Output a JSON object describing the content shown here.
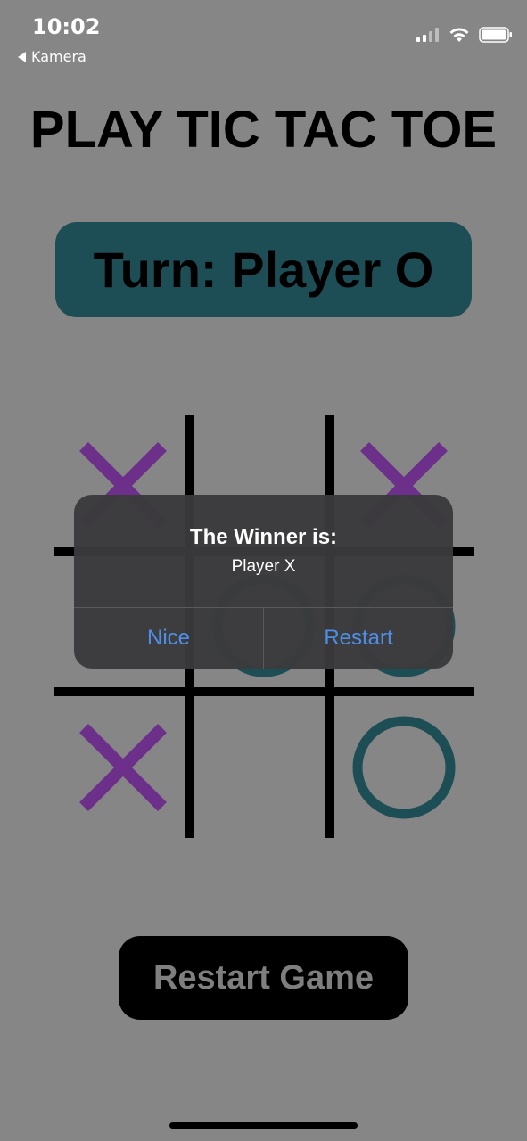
{
  "status_bar": {
    "time": "10:02",
    "back_label": "Kamera",
    "icons": [
      "cellular-signal-icon",
      "wifi-icon",
      "battery-icon"
    ]
  },
  "title": "PLAY TIC TAC TOE",
  "turn_label": "Turn: Player O",
  "board": {
    "cells": [
      "X",
      "",
      "X",
      "",
      "O",
      "O",
      "X",
      "",
      "O"
    ]
  },
  "alert": {
    "title": "The Winner is:",
    "message": "Player X",
    "buttons": [
      "Nice",
      "Restart"
    ]
  },
  "restart_button_label": "Restart Game",
  "colors": {
    "background": "#868686",
    "x_mark": "#6c2f8a",
    "o_mark": "#1d4e56",
    "turn_box": "#1d4e56",
    "alert_button_text": "#4d8fe6"
  }
}
